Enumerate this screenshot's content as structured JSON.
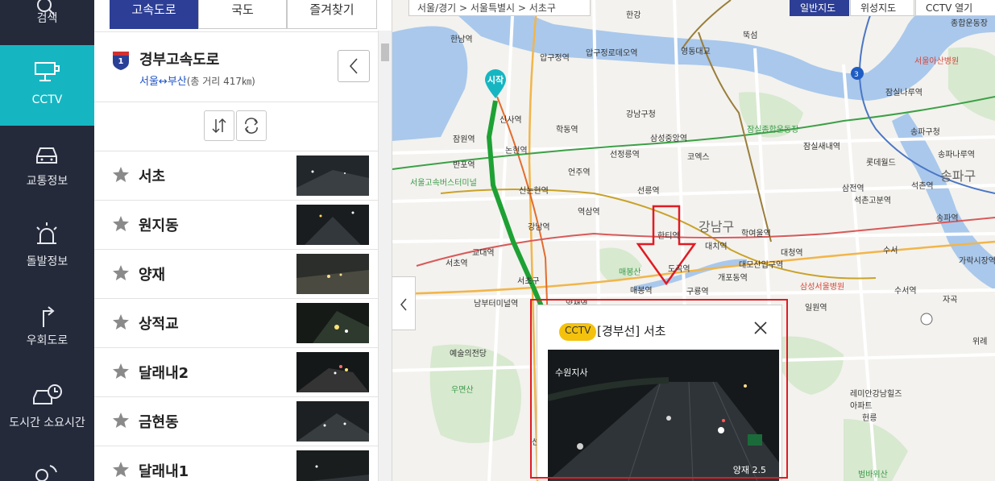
{
  "nav": {
    "items": [
      {
        "label": "검색",
        "icon": "search-icon"
      },
      {
        "label": "CCTV",
        "icon": "cctv-icon"
      },
      {
        "label": "교통정보",
        "icon": "car-icon"
      },
      {
        "label": "돌발정보",
        "icon": "siren-icon"
      },
      {
        "label": "우회도로",
        "icon": "detour-arrow-icon"
      },
      {
        "label": "도시간 소요시간",
        "icon": "car-clock-icon"
      }
    ]
  },
  "tabs": [
    "고속도로",
    "국도",
    "즐겨찾기"
  ],
  "route": {
    "shield_number": "1",
    "name": "경부고속도로",
    "endpoints": "서울↔부산",
    "distance": "(총 거리 417㎞)"
  },
  "cctv_list": [
    "서초",
    "원지동",
    "양재",
    "상적교",
    "달래내2",
    "금현동",
    "달래내1"
  ],
  "map": {
    "breadcrumb": "서울/경기 > 서울특별시 > 서초구",
    "buttons": [
      "일반지도",
      "위성지도",
      "CCTV 열기"
    ],
    "start_pin": "시작",
    "labels": [
      {
        "t": "한강",
        "c": ""
      },
      {
        "t": "한남역",
        "c": ""
      },
      {
        "t": "압구정역",
        "c": ""
      },
      {
        "t": "압구정로데오역",
        "c": ""
      },
      {
        "t": "영동대교",
        "c": ""
      },
      {
        "t": "뚝섬",
        "c": ""
      },
      {
        "t": "종합운동장",
        "c": ""
      },
      {
        "t": "서울아산병원",
        "c": "red"
      },
      {
        "t": "잠실나루역",
        "c": ""
      },
      {
        "t": "신사역",
        "c": ""
      },
      {
        "t": "학동역",
        "c": ""
      },
      {
        "t": "강남구청",
        "c": ""
      },
      {
        "t": "잠원역",
        "c": ""
      },
      {
        "t": "반포역",
        "c": ""
      },
      {
        "t": "논현역",
        "c": ""
      },
      {
        "t": "선정릉역",
        "c": ""
      },
      {
        "t": "삼성중앙역",
        "c": ""
      },
      {
        "t": "코엑스",
        "c": ""
      },
      {
        "t": "잠실종합운동장",
        "c": "green"
      },
      {
        "t": "잠실새내역",
        "c": ""
      },
      {
        "t": "롯데월드",
        "c": ""
      },
      {
        "t": "송파구청",
        "c": ""
      },
      {
        "t": "송파나루역",
        "c": ""
      },
      {
        "t": "송파구",
        "c": "big"
      },
      {
        "t": "서울고속버스터미널",
        "c": "green"
      },
      {
        "t": "신논현역",
        "c": ""
      },
      {
        "t": "언주역",
        "c": ""
      },
      {
        "t": "선릉역",
        "c": ""
      },
      {
        "t": "삼전역",
        "c": ""
      },
      {
        "t": "석촌고분역",
        "c": ""
      },
      {
        "t": "석촌역",
        "c": ""
      },
      {
        "t": "송파역",
        "c": ""
      },
      {
        "t": "역삼역",
        "c": ""
      },
      {
        "t": "강남역",
        "c": ""
      },
      {
        "t": "강남구",
        "c": "big"
      },
      {
        "t": "한티역",
        "c": ""
      },
      {
        "t": "대치역",
        "c": ""
      },
      {
        "t": "학여울역",
        "c": ""
      },
      {
        "t": "교대역",
        "c": ""
      },
      {
        "t": "서초역",
        "c": ""
      },
      {
        "t": "매봉산",
        "c": "green"
      },
      {
        "t": "도곡역",
        "c": ""
      },
      {
        "t": "대청역",
        "c": ""
      },
      {
        "t": "수서",
        "c": ""
      },
      {
        "t": "가락시장역",
        "c": ""
      },
      {
        "t": "서초구",
        "c": ""
      },
      {
        "t": "양재역",
        "c": ""
      },
      {
        "t": "매봉역",
        "c": ""
      },
      {
        "t": "구룡역",
        "c": ""
      },
      {
        "t": "개포동역",
        "c": ""
      },
      {
        "t": "대모산입구역",
        "c": ""
      },
      {
        "t": "삼성서울병원",
        "c": "red"
      },
      {
        "t": "수서역",
        "c": ""
      },
      {
        "t": "남부터미널역",
        "c": ""
      },
      {
        "t": "일원역",
        "c": ""
      },
      {
        "t": "자곡",
        "c": ""
      },
      {
        "t": "예술의전당",
        "c": ""
      },
      {
        "t": "우면산",
        "c": "green"
      },
      {
        "t": "레미안강남힐즈아파트",
        "c": ""
      },
      {
        "t": "헌릉",
        "c": ""
      },
      {
        "t": "선암",
        "c": ""
      },
      {
        "t": "범바위산",
        "c": "green"
      },
      {
        "t": "위례",
        "c": ""
      }
    ]
  },
  "popup": {
    "badge": "CCTV",
    "title": "[경부선] 서초",
    "video_label": "수원지사",
    "video_marker": "양재 2.5"
  },
  "colors": {
    "nav_bg": "#242a3a",
    "nav_active": "#15b6c2",
    "tab_active": "#2c3e95",
    "route_line": "#1ea134",
    "start_pin": "#15b6c2",
    "annotation": "#e01b24",
    "badge": "#f4c20d"
  }
}
